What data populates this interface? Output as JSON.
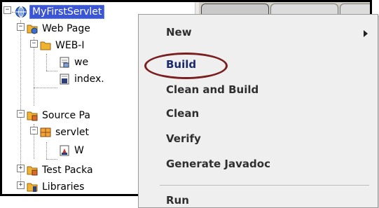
{
  "project_tree": {
    "items": [
      {
        "label": "MyFirstServlet",
        "icon": "globe-icon"
      },
      {
        "label": "Web Page",
        "icon": "web-pages-folder-icon"
      },
      {
        "label": "WEB-I",
        "icon": "folder-icon"
      },
      {
        "label": "we",
        "icon": "xml-file-icon"
      },
      {
        "label": "index.",
        "icon": "jsp-file-icon"
      },
      {
        "label": "Source Pa",
        "icon": "source-packages-icon"
      },
      {
        "label": "servlet",
        "icon": "package-icon"
      },
      {
        "label": "W",
        "icon": "java-file-icon"
      },
      {
        "label": "Test Packa",
        "icon": "test-packages-icon"
      },
      {
        "label": "Libraries",
        "icon": "libraries-icon"
      }
    ]
  },
  "context_menu": {
    "new": "New",
    "build": "Build",
    "clean_and_build": "Clean and Build",
    "clean": "Clean",
    "verify": "Verify",
    "generate_javadoc": "Generate Javadoc",
    "run": "Run"
  },
  "colors": {
    "selection": "#3a55d6",
    "highlight_ring": "#7a1f20",
    "menu_background": "#efefef"
  }
}
